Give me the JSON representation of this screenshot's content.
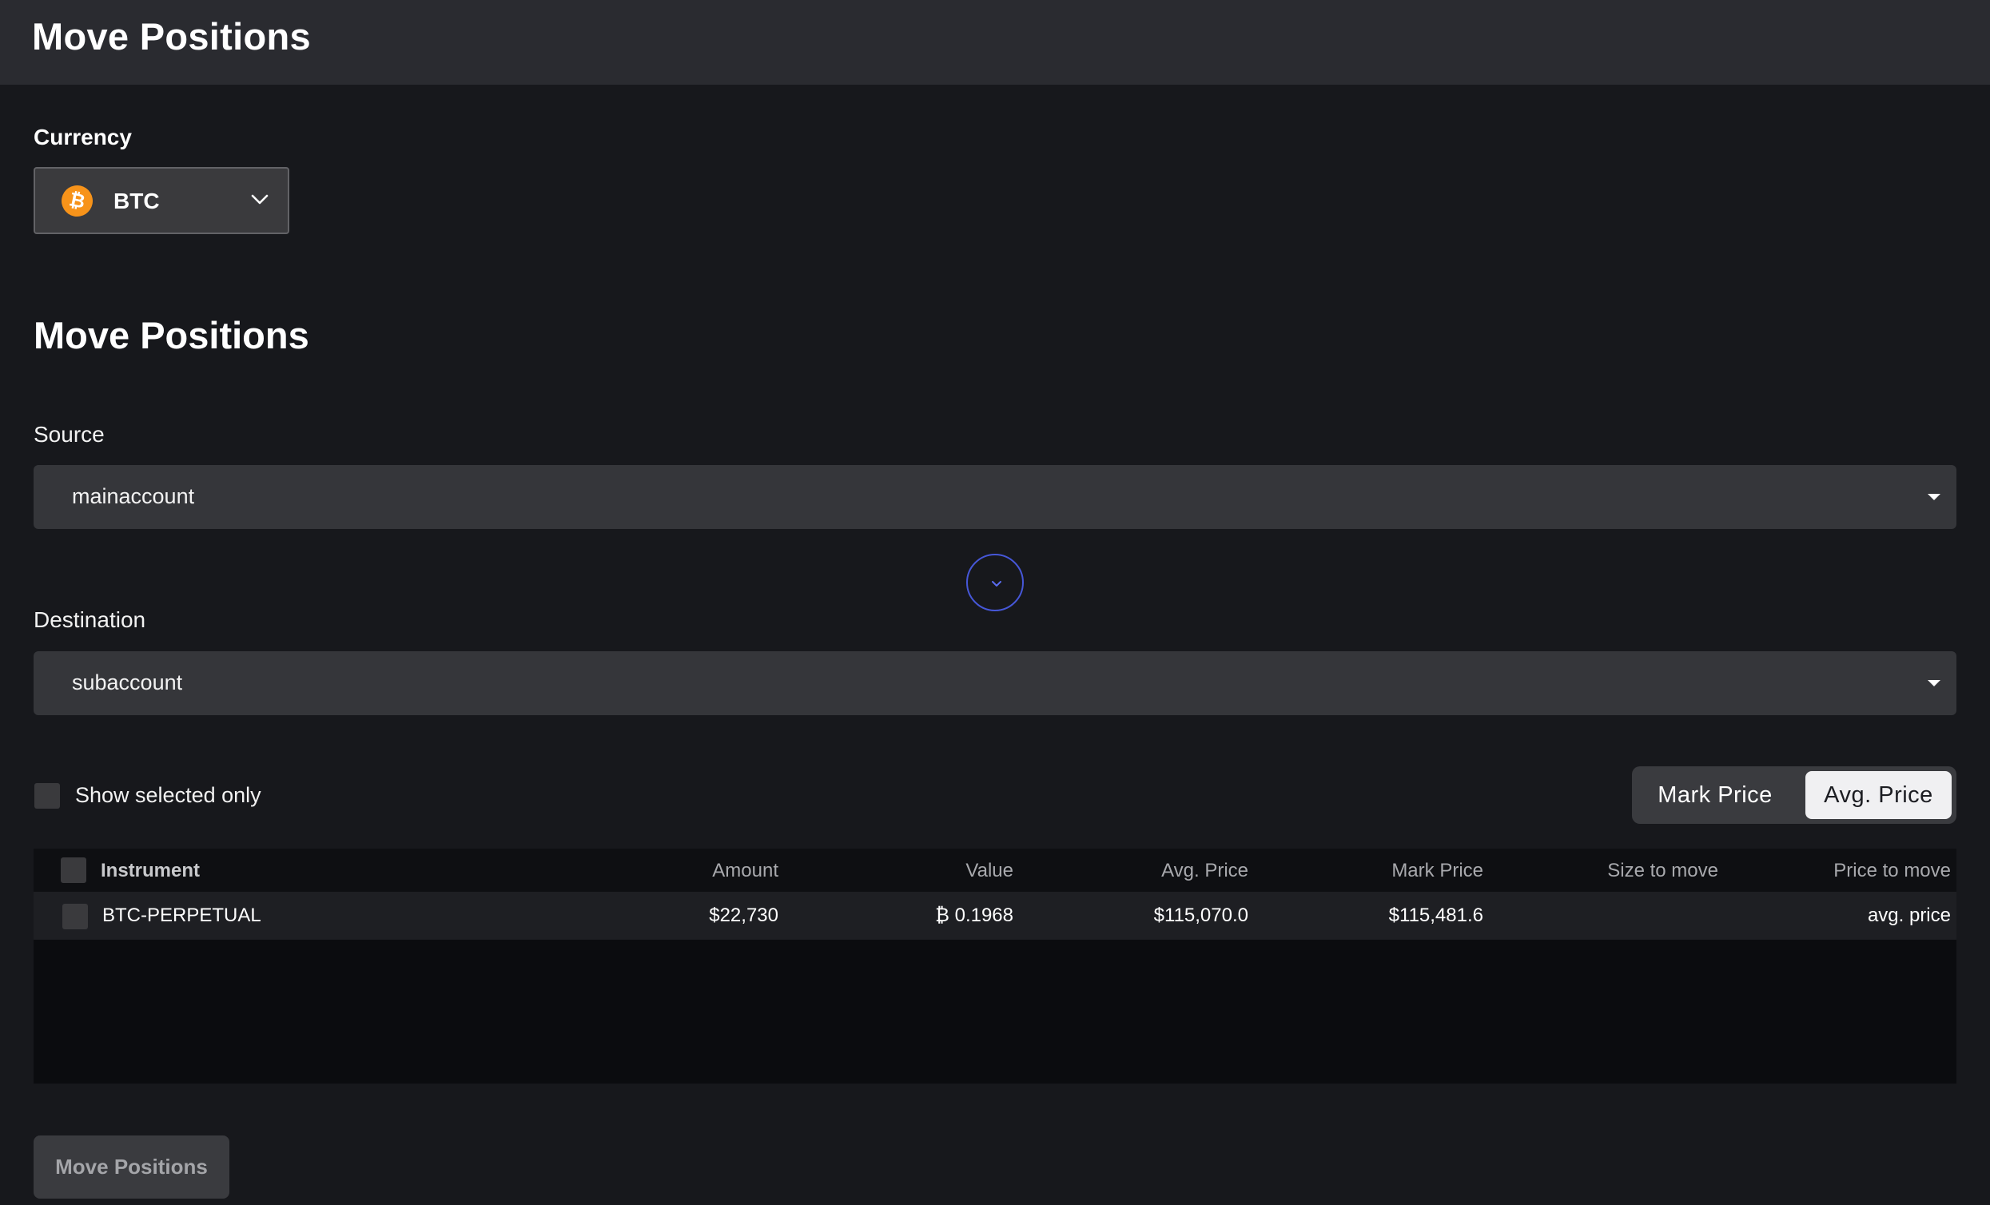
{
  "header": {
    "title": "Move Positions"
  },
  "currency": {
    "label": "Currency",
    "selected": "BTC",
    "coin_symbol": "₿",
    "coin_color": "#f7931a",
    "icons": {
      "coin": "bitcoin-icon",
      "chevron": "chevron-down-icon"
    }
  },
  "section": {
    "title": "Move Positions"
  },
  "source": {
    "label": "Source",
    "value": "mainaccount"
  },
  "destination": {
    "label": "Destination",
    "value": "subaccount"
  },
  "swap": {
    "icon": "chevron-down-icon",
    "color": "#4657d8"
  },
  "filter": {
    "show_selected_label": "Show selected only"
  },
  "price_toggle": {
    "options": [
      "Mark Price",
      "Avg. Price"
    ],
    "selected": "Avg. Price"
  },
  "table": {
    "columns": [
      "Instrument",
      "Amount",
      "Value",
      "Avg. Price",
      "Mark Price",
      "Size to move",
      "Price to move"
    ],
    "rows": [
      {
        "instrument": "BTC-PERPETUAL",
        "amount": "$22,730",
        "value": "₿ 0.1968",
        "avg_price": "$115,070.0",
        "mark_price": "$115,481.6",
        "size_to_move": "",
        "price_to_move": "avg. price"
      }
    ]
  },
  "actions": {
    "move_label": "Move Positions"
  }
}
